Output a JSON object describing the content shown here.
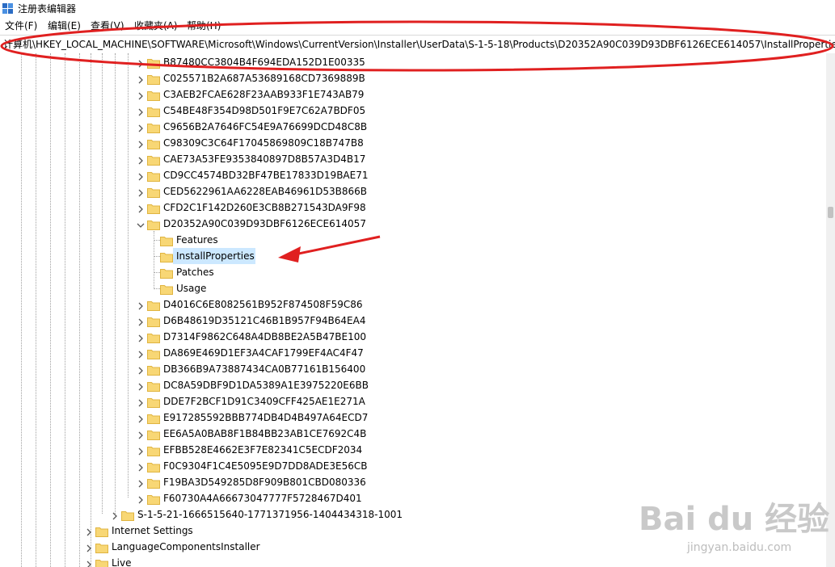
{
  "window": {
    "title": "注册表编辑器",
    "icon": "regedit-icon"
  },
  "menu": [
    "文件(F)",
    "编辑(E)",
    "查看(V)",
    "收藏夹(A)",
    "帮助(H)"
  ],
  "address": "计算机\\HKEY_LOCAL_MACHINE\\SOFTWARE\\Microsoft\\Windows\\CurrentVersion\\Installer\\UserData\\S-1-5-18\\Products\\D20352A90C039D93DBF6126ECE614057\\InstallProperties",
  "tree": {
    "products": [
      "B87480CC3804B4F694EDA152D1E00335",
      "C025571B2A687A53689168CD7369889B",
      "C3AEB2FCAE628F23AAB933F1E743AB79",
      "C54BE48F354D98D501F9E7C62A7BDF05",
      "C9656B2A7646FC54E9A76699DCD48C8B",
      "C98309C3C64F17045869809C18B747B8",
      "CAE73A53FE9353840897D8B57A3D4B17",
      "CD9CC4574BD32BF47BE17833D19BAE71",
      "CED5622961AA6228EAB46961D53B866B",
      "CFD2C1F142D260E3CB8B271543DA9F98",
      "D20352A90C039D93DBF6126ECE614057"
    ],
    "expanded_children": [
      "Features",
      "InstallProperties",
      "Patches",
      "Usage"
    ],
    "selected": "InstallProperties",
    "products_after": [
      "D4016C6E8082561B952F874508F59C86",
      "D6B48619D35121C46B1B957F94B64EA4",
      "D7314F9862C648A4DB8BE2A5B47BE100",
      "DA869E469D1EF3A4CAF1799EF4AC4F47",
      "DB366B9A73887434CA0B77161B156400",
      "DC8A59DBF9D1DA5389A1E3975220E6BB",
      "DDE7F2BCF1D91C3409CFF425AE1E271A",
      "E917285592BBB774DB4D4B497A64ECD7",
      "EE6A5A0BAB8F1B84BB23AB1CE7692C4B",
      "EFBB528E4662E3F7E82341C5ECDF2034",
      "F0C9304F1C4E5095E9D7DD8ADE3E56CB",
      "F19BA3D549285D8F909B801CBD080336",
      "F60730A4A66673047777F5728467D401"
    ],
    "sid_user": "S-1-5-21-1666515640-1771371956-1404434318-1001",
    "siblings": [
      "Internet Settings",
      "LanguageComponentsInstaller",
      "Live"
    ]
  },
  "colors": {
    "folder": "#f8d775",
    "folder_edge": "#e0b440",
    "selection": "#cce8ff",
    "annotation": "#e02020"
  },
  "watermark": {
    "main": "Bai du 经验",
    "sub": "jingyan.baidu.com"
  }
}
